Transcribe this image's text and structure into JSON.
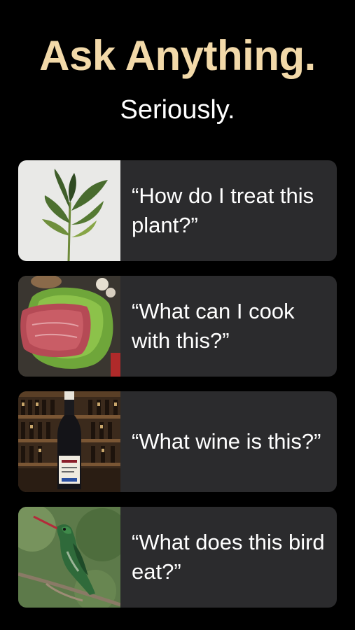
{
  "header": {
    "title": "Ask Anything.",
    "subtitle": "Seriously."
  },
  "cards": [
    {
      "question": "“How do I treat this plant?”",
      "image": "rubber-plant-photo"
    },
    {
      "question": "“What can I cook with this?”",
      "image": "raw-beef-photo"
    },
    {
      "question": "“What wine is this?”",
      "image": "wine-bottle-photo"
    },
    {
      "question": "“What does this bird eat?”",
      "image": "hummingbird-photo"
    }
  ],
  "colors": {
    "background": "#000000",
    "title": "#f2d9a9",
    "card": "#2b2b2d",
    "text": "#ffffff"
  }
}
